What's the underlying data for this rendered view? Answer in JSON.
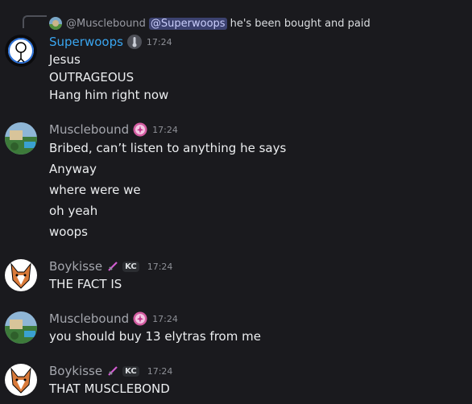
{
  "reply": {
    "author": "@Musclebound",
    "mention": "@Superwoops",
    "text": "he's been bought and paid"
  },
  "messages": [
    {
      "author": "Superwoops",
      "time": "17:24",
      "lines": [
        "Jesus",
        "OUTRAGEOUS",
        "Hang him right now"
      ]
    },
    {
      "author": "Musclebound",
      "time": "17:24",
      "lines": [
        "Bribed, can’t listen to anything he says",
        "Anyway",
        "where were we",
        "oh yeah",
        "woops"
      ]
    },
    {
      "author": "Boykisse",
      "tag": "KC",
      "time": "17:24",
      "lines": [
        "THE FACT IS"
      ]
    },
    {
      "author": "Musclebound",
      "time": "17:24",
      "lines": [
        "you should buy 13 elytras from me"
      ]
    },
    {
      "author": "Boykisse",
      "tag": "KC",
      "time": "17:24",
      "lines": [
        "THAT MUSCLEBOND"
      ]
    }
  ],
  "colors": {
    "background": "#1a1a1e",
    "superwoops_name": "#3aa6f0",
    "default_name": "#a4a6ad",
    "mention_bg": "#3c4270"
  },
  "icons": {
    "superwoops_badge": "vial-icon",
    "musclebound_badge": "pink-star-badge-icon",
    "boykisse_badge": "sword-icon"
  }
}
